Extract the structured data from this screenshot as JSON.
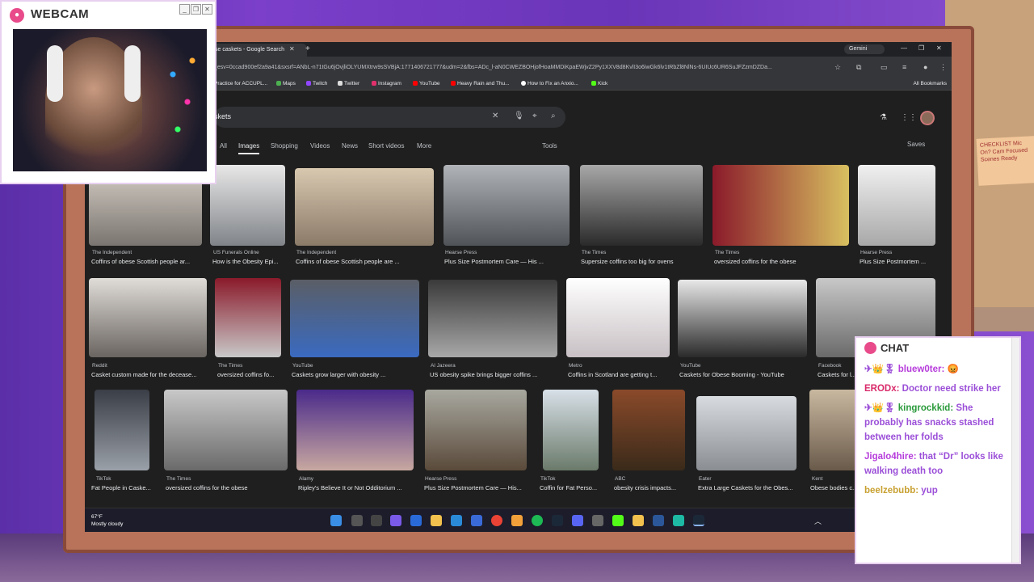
{
  "webcam": {
    "title": "WEBCAM",
    "icon": "camera-icon"
  },
  "chat": {
    "title": "CHAT",
    "messages": [
      {
        "user": "bluew0ter:",
        "text": "",
        "badges": "✈👑🎖"
      },
      {
        "user": "ERODx:",
        "text": "Doctor need strike her"
      },
      {
        "user": "kingrockkid:",
        "text": "She probably has snacks stashed between her folds",
        "badges": "✈👑🎖"
      },
      {
        "user": "Jigalo4hire:",
        "text": "that “Dr” looks like walking death too"
      },
      {
        "user": "beelzebubb:",
        "text": "yup"
      }
    ]
  },
  "browser": {
    "tab_title": "se caskets - Google Search",
    "gemini": "Gemini",
    "url": "_esv=0ccad900ef2a9a41&sxsrf=ANbL-n71tGu6jOvjliOLYUMXtrw9sSVBjA:1771406721777&udm=2&fbs=ADc_l-aN0CWEZBOHjofHoaMMDiKpaEWjvZ2Py1XXV8d8KvlI3o6iwGk6lv1tRbZl8NlNs-6UIUc6UR6SuJFZzmDZDa...",
    "bookmarks": [
      "Practice for ACCUPL...",
      "Maps",
      "Twitch",
      "Twitter",
      "Instagram",
      "YouTube",
      "Heavy Rain and Thu...",
      "How to Fix an Anxio...",
      "Kick"
    ],
    "all_bookmarks": "All Bookmarks",
    "search_query": "skets",
    "tabs": [
      "All",
      "Images",
      "Shopping",
      "Videos",
      "News",
      "Short videos",
      "More"
    ],
    "active_tab": "Images",
    "tools": "Tools",
    "saves": "Saves",
    "results_row1": [
      {
        "src": "The Independent",
        "title": "Coffins of obese Scottish people ar..."
      },
      {
        "src": "US Funerals Online",
        "title": "How is the Obesity Epi..."
      },
      {
        "src": "The Independent",
        "title": "Coffins of obese Scottish people are ..."
      },
      {
        "src": "Hearse Press",
        "title": "Plus Size Postmortem Care — His ..."
      },
      {
        "src": "The Times",
        "title": "Supersize coffins too big for ovens"
      },
      {
        "src": "The Times",
        "title": "oversized coffins for the obese"
      },
      {
        "src": "Hearse Press",
        "title": "Plus Size Postmortem ..."
      }
    ],
    "results_row2": [
      {
        "src": "Reddit",
        "title": "Casket custom made for the decease..."
      },
      {
        "src": "The Times",
        "title": "oversized coffins fo..."
      },
      {
        "src": "YouTube",
        "title": "Caskets grow larger with obesity ..."
      },
      {
        "src": "Al Jazeera",
        "title": "US obesity spike brings bigger coffins ..."
      },
      {
        "src": "Metro",
        "title": "Coffins in Scotland are getting t..."
      },
      {
        "src": "YouTube",
        "title": "Caskets for Obese Booming - YouTube"
      },
      {
        "src": "Facebook",
        "title": "Caskets for l..."
      }
    ],
    "results_row3": [
      {
        "src": "TikTok",
        "title": "Fat People in Caske..."
      },
      {
        "src": "The Times",
        "title": "oversized coffins for the obese"
      },
      {
        "src": "Alamy",
        "title": "Ripley's Believe It or Not Odditorium ..."
      },
      {
        "src": "Hearse Press",
        "title": "Plus Size Postmortem Care — His..."
      },
      {
        "src": "TikTok",
        "title": "Coffin for Fat Perso..."
      },
      {
        "src": "ABC",
        "title": "obesity crisis impacts..."
      },
      {
        "src": "Eater",
        "title": "Extra Large Caskets for the Obes..."
      },
      {
        "src": "Kent",
        "title": "Obese bodies c..."
      }
    ]
  },
  "taskbar": {
    "temp": "67°F",
    "weather": "Mostly cloudy"
  },
  "note": {
    "text": "CHECKLIST Mic On? Cam Focused Scenes Ready"
  },
  "colors": {
    "accent": "#b63cdb",
    "frame": "#b8735a",
    "bg": "#6a35b8"
  }
}
